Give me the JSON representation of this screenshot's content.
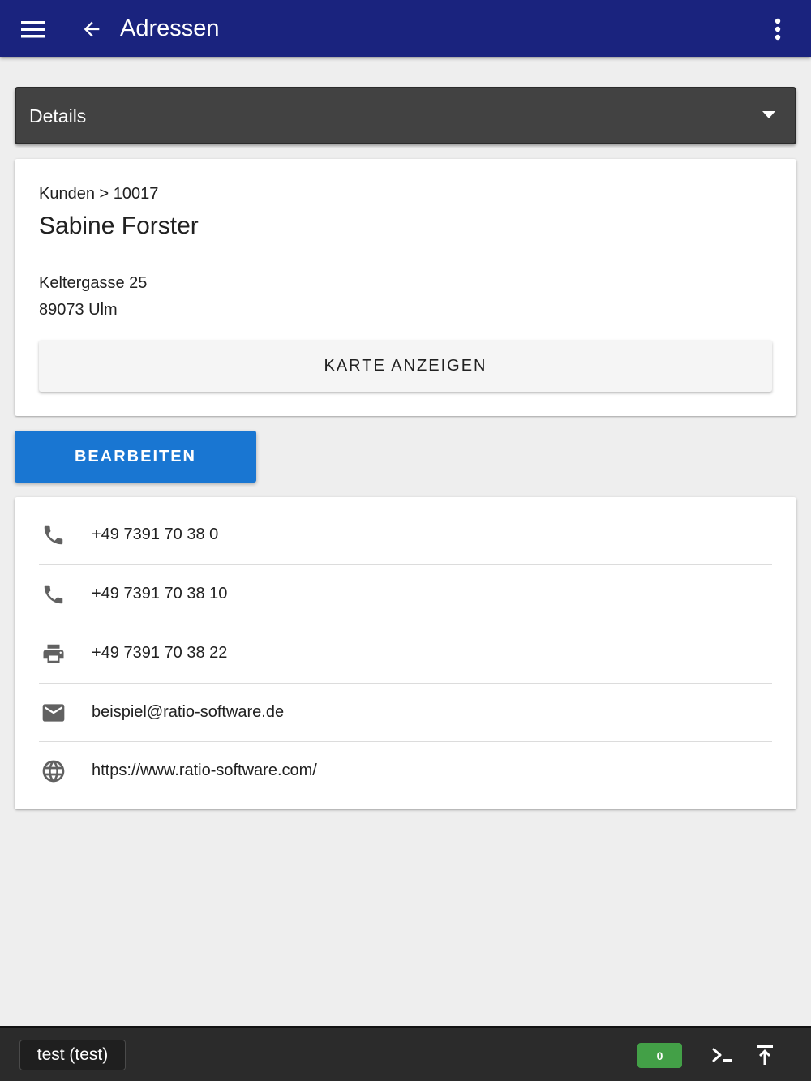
{
  "appbar": {
    "title": "Adressen",
    "menu_icon": "menu-icon",
    "back_icon": "arrow-back-icon",
    "more_icon": "more-vert-icon",
    "color": "#1a237e"
  },
  "details": {
    "label": "Details",
    "icon": "caret-down-icon"
  },
  "address": {
    "breadcrumb": "Kunden > 10017",
    "name": "Sabine Forster",
    "street": "Keltergasse 25",
    "city": "89073 Ulm",
    "map_button": "KARTE ANZEIGEN"
  },
  "edit_button": {
    "label": "BEARBEITEN",
    "color": "#1976d2"
  },
  "contacts": [
    {
      "icon": "phone-icon",
      "value": "+49 7391 70 38 0"
    },
    {
      "icon": "phone-icon",
      "value": "+49 7391 70 38 10"
    },
    {
      "icon": "print-icon",
      "value": "+49 7391 70 38 22"
    },
    {
      "icon": "mail-icon",
      "value": "beispiel@ratio-software.de"
    },
    {
      "icon": "globe-icon",
      "value": "https://www.ratio-software.com/"
    }
  ],
  "bottombar": {
    "user": "test (test)",
    "count": "0",
    "count_color": "#43a047",
    "terminal_icon": "terminal-icon",
    "top_icon": "scroll-to-top-icon"
  }
}
